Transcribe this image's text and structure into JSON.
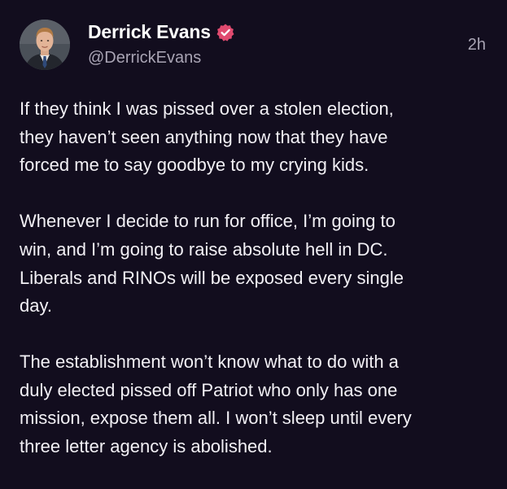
{
  "post": {
    "author": {
      "name": "Derrick Evans",
      "handle": "@DerrickEvans",
      "verified": true,
      "avatar_icon": "profile-photo"
    },
    "timestamp": "2h",
    "paragraphs": [
      "If they think I was pissed over a stolen election,\nthey haven’t seen anything now that they have\nforced me to say goodbye to my crying kids.",
      "Whenever I decide to run for office, I’m going to\nwin, and I’m going to raise absolute hell in DC.\nLiberals and RINOs will be exposed every single\nday.",
      "The establishment won’t know what to do with a\nduly elected pissed off Patriot who only has one\nmission, expose them all. I won’t sleep until every\nthree letter agency is abolished."
    ]
  },
  "colors": {
    "background": "#120d1e",
    "text": "#f2f0f5",
    "muted": "#a9a4b4",
    "verified_badge": "#e04a6f"
  }
}
